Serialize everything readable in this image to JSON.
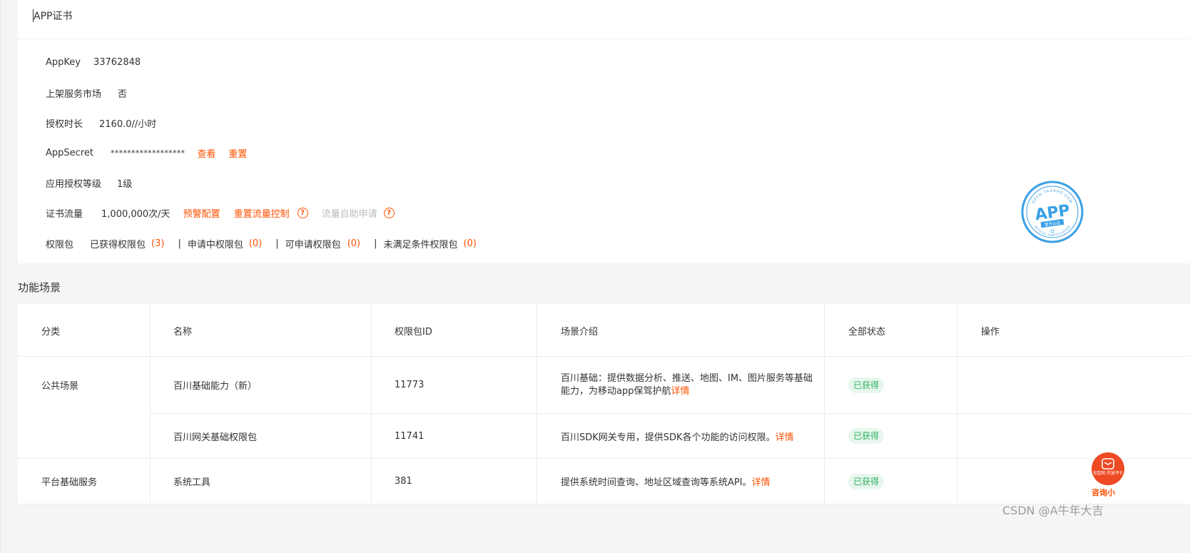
{
  "cert": {
    "title": "APP证书",
    "appkey_label": "AppKey",
    "appkey_value": "33762848",
    "market_label": "上架服务市场",
    "market_value": "否",
    "duration_label": "授权时长",
    "duration_value": "2160.0//小时",
    "secret_label": "AppSecret",
    "secret_value": "******************",
    "view_link": "查看",
    "reset_link": "重置",
    "level_label": "应用授权等级",
    "level_value": "1级",
    "flow_label": "证书流量",
    "flow_value": "1,000,000次/天",
    "alert_config_link": "预警配置",
    "reset_flow_link": "重置流量控制",
    "self_apply_link": "流量自助申请",
    "help_glyph": "?",
    "perm_label": "权限包",
    "perm_obtained_label": "已获得权限包",
    "perm_obtained_count": "(3)",
    "perm_applying_label": "申请中权限包",
    "perm_applying_count": "(0)",
    "perm_applicable_label": "可申请权限包",
    "perm_applicable_count": "(0)",
    "perm_unmet_label": "未满足条件权限包",
    "perm_unmet_count": "(0)",
    "separator": "|"
  },
  "stamp": {
    "top_text": "OPEN.TAOBAO.COM",
    "main_text": "APP",
    "sub_text": "官方认证",
    "bottom_text": "OFFICIAL CERTIFICATION",
    "color": "#3aa0e6"
  },
  "scenes": {
    "title": "功能场景",
    "headers": [
      "分类",
      "名称",
      "权限包ID",
      "场景介绍",
      "全部状态",
      "操作"
    ],
    "group1": "公共场景",
    "group2": "平台基础服务",
    "rows": [
      {
        "name": "百川基础能力（新）",
        "id": "11773",
        "desc": "百川基础：提供数据分析、推送、地图、IM、图片服务等基础能力，为移动app保驾护航",
        "detail": "详情",
        "status": "已获得"
      },
      {
        "name": "百川网关基础权限包",
        "id": "11741",
        "desc": "百川SDK网关专用，提供SDK各个功能的访问权限。",
        "detail": "详情",
        "status": "已获得"
      },
      {
        "name": "系统工具",
        "id": "381",
        "desc": "提供系统时间查询、地址区域查询等系统API。",
        "detail": "详情",
        "status": "已获得"
      }
    ]
  },
  "consult": {
    "icon_text": "淘宝网 开放平台",
    "label": "咨询小"
  },
  "watermark": "CSDN @A牛年大吉",
  "colors": {
    "accent": "#ff5000",
    "success_text": "#2fb260",
    "success_bg": "#e8f7ee"
  }
}
